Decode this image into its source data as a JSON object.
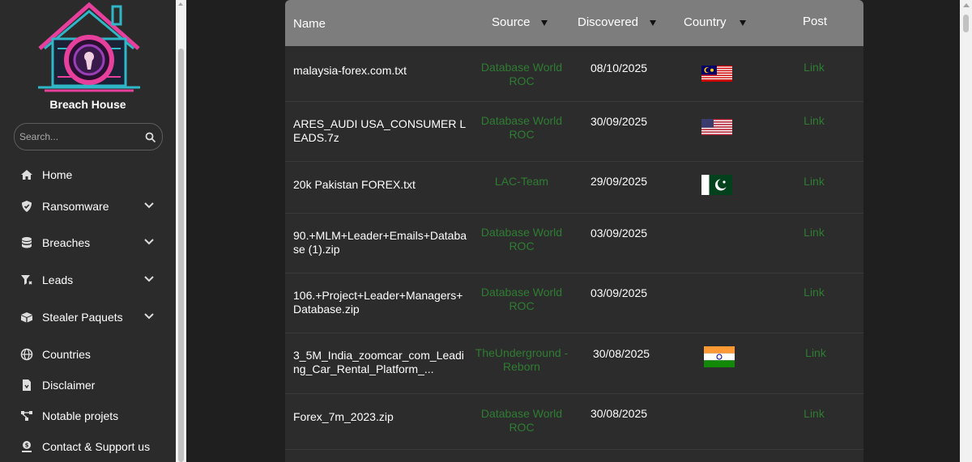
{
  "brand": {
    "name": "Breach House"
  },
  "search": {
    "placeholder": "Search..."
  },
  "nav": [
    {
      "label": "Home",
      "icon": "home-icon",
      "expandable": false
    },
    {
      "label": "Ransomware",
      "icon": "shield-icon",
      "expandable": true
    },
    {
      "label": "Breaches",
      "icon": "database-icon",
      "expandable": true
    },
    {
      "label": "Leads",
      "icon": "filter-icon",
      "expandable": true
    },
    {
      "label": "Stealer Paquets",
      "icon": "box-icon",
      "expandable": true
    },
    {
      "label": "Countries",
      "icon": "globe-icon",
      "expandable": false
    },
    {
      "label": "Disclaimer",
      "icon": "document-icon",
      "expandable": false
    },
    {
      "label": "Notable projets",
      "icon": "network-icon",
      "expandable": false
    },
    {
      "label": "Contact & Support us",
      "icon": "support-icon",
      "expandable": false
    }
  ],
  "table": {
    "headers": {
      "name": "Name",
      "source": "Source",
      "discovered": "Discovered",
      "country": "Country",
      "post": "Post"
    },
    "rows": [
      {
        "name": "malaysia-forex.com.txt",
        "source": "Database World ROC",
        "discovered": "08/10/2025",
        "country": "malaysia-flag",
        "post": "Link"
      },
      {
        "name": "ARES_AUDI USA_CONSUMER LEADS.7z",
        "source": "Database World ROC",
        "discovered": "30/09/2025",
        "country": "usa-flag",
        "post": "Link"
      },
      {
        "name": "20k Pakistan FOREX.txt",
        "source": "LAC-Team",
        "discovered": "29/09/2025",
        "country": "pakistan-flag",
        "post": "Link"
      },
      {
        "name": "90.+MLM+Leader+Emails+Database (1).zip",
        "source": "Database World ROC",
        "discovered": "03/09/2025",
        "country": "",
        "post": "Link"
      },
      {
        "name": "106.+Project+Leader+Managers+Database.zip",
        "source": "Database World ROC",
        "discovered": "03/09/2025",
        "country": "",
        "post": "Link"
      },
      {
        "name": "3_5M_India_zoomcar_com_Leading_Car_Rental_Platform_...",
        "source": "TheUnderground - Reborn",
        "discovered": "30/08/2025",
        "country": "india-flag",
        "post": "Link"
      },
      {
        "name": "Forex_7m_2023.zip",
        "source": "Database World ROC",
        "discovered": "30/08/2025",
        "country": "",
        "post": "Link"
      }
    ]
  },
  "colors": {
    "sidebar_bg": "#2b2b2b",
    "header_bg": "#7d7d7d",
    "table_bg": "#2c2c2c",
    "accent_green": "#2e7d32",
    "page_bg": "#1f1f1f"
  }
}
